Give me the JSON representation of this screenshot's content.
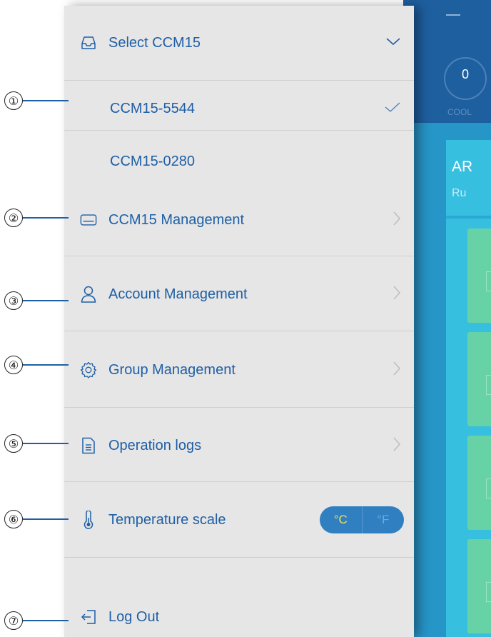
{
  "menu": {
    "select": {
      "label": "Select CCM15"
    },
    "devices": [
      {
        "label": "CCM15-5544",
        "selected": true
      },
      {
        "label": "CCM15-0280",
        "selected": false
      }
    ],
    "items": [
      {
        "label": "CCM15 Management",
        "icon": "device-icon"
      },
      {
        "label": "Account Management",
        "icon": "person-icon"
      },
      {
        "label": "Group Management",
        "icon": "gear-icon"
      },
      {
        "label": "Operation logs",
        "icon": "document-icon"
      }
    ],
    "temperature": {
      "label": "Temperature scale",
      "options": [
        "°C",
        "°F"
      ],
      "selected": "°C"
    },
    "logout": {
      "label": "Log Out"
    }
  },
  "callouts": [
    "①",
    "②",
    "③",
    "④",
    "⑤",
    "⑥",
    "⑦"
  ],
  "app": {
    "counter": "0",
    "mode": "COOL",
    "panel_title": "AR",
    "panel_subtitle": "Ru"
  },
  "colors": {
    "accent": "#1f5fa6",
    "sidebar_bg": "#e6e6e6",
    "toggle_bg": "#2f7fc1",
    "toggle_active_text": "#f4e24a",
    "app_header": "#1e5f9f",
    "panel": "#37bfe0",
    "tile": "#67d2a6"
  }
}
